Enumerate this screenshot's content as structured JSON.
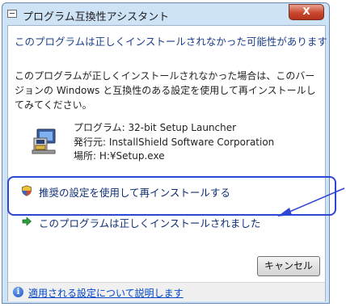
{
  "window": {
    "title": "プログラム互換性アシスタント",
    "close_glyph": "X"
  },
  "main_header": "このプログラムは正しくインストールされなかった可能性があります",
  "body_text": "このプログラムが正しくインストールされなかった場合は、このバージョンの Windows と互換性のある設定を使用して再インストールしてみてください。",
  "program_info": {
    "program": "プログラム: 32-bit Setup Launcher",
    "publisher": "発行元: InstallShield Software Corporation",
    "location": "場所: H:¥Setup.exe"
  },
  "commands": {
    "recommended": "推奨の設定を使用して再インストールする",
    "installed_correctly": "このプログラムは正しくインストールされました"
  },
  "cancel_label": "キャンセル",
  "footer_link": "適用される設定について説明します",
  "colors": {
    "accent": "#1a3e8a",
    "annotation": "#2f45d6",
    "close_button": "#c9472d"
  }
}
